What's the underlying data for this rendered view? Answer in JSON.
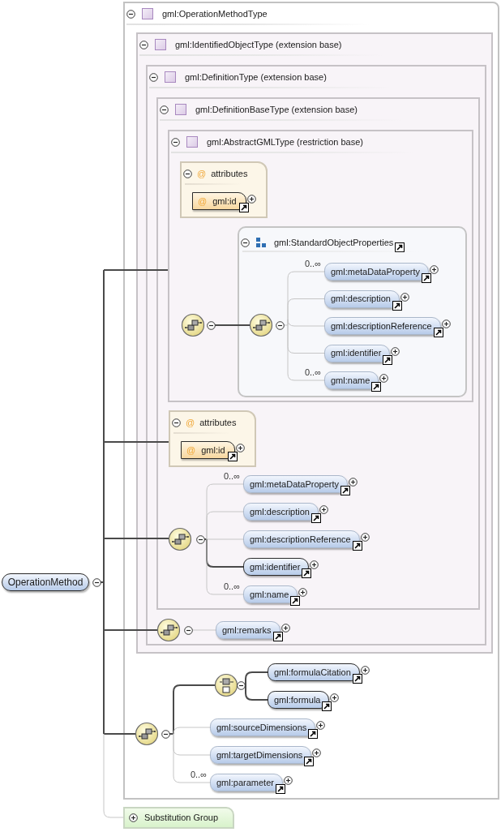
{
  "root": {
    "label": "OperationMethod"
  },
  "types": [
    {
      "title": "gml:OperationMethodType"
    },
    {
      "title": "gml:IdentifiedObjectType (extension base)"
    },
    {
      "title": "gml:DefinitionType (extension base)"
    },
    {
      "title": "gml:DefinitionBaseType (extension base)"
    },
    {
      "title": "gml:AbstractGMLType (restriction base)"
    }
  ],
  "inner_attributes": {
    "marker": "@",
    "title": "attributes",
    "items": [
      {
        "marker": "@",
        "label": "gml:id"
      }
    ]
  },
  "group": {
    "title": "gml:StandardObjectProperties",
    "elements": [
      {
        "label": "gml:metaDataProperty",
        "occurs": "0..∞",
        "required": false
      },
      {
        "label": "gml:description",
        "required": false
      },
      {
        "label": "gml:descriptionReference",
        "required": false
      },
      {
        "label": "gml:identifier",
        "required": false
      },
      {
        "label": "gml:name",
        "occurs": "0..∞",
        "required": false
      }
    ]
  },
  "outer_attributes": {
    "marker": "@",
    "title": "attributes",
    "items": [
      {
        "marker": "@",
        "label": "gml:id"
      }
    ]
  },
  "definition_sequence": {
    "elements": [
      {
        "label": "gml:metaDataProperty",
        "occurs": "0..∞",
        "required": false
      },
      {
        "label": "gml:description",
        "required": false
      },
      {
        "label": "gml:descriptionReference",
        "required": false
      },
      {
        "label": "gml:identifier",
        "required": true
      },
      {
        "label": "gml:name",
        "occurs": "0..∞",
        "required": false
      }
    ]
  },
  "remarks_sequence": {
    "elements": [
      {
        "label": "gml:remarks",
        "required": false
      }
    ]
  },
  "method_sequence": {
    "choice": {
      "required": true,
      "elements": [
        {
          "label": "gml:formulaCitation",
          "required": true
        },
        {
          "label": "gml:formula",
          "required": true
        }
      ]
    },
    "elements": [
      {
        "label": "gml:sourceDimensions",
        "required": false
      },
      {
        "label": "gml:targetDimensions",
        "required": false
      },
      {
        "label": "gml:parameter",
        "occurs": "0..∞",
        "required": false
      }
    ]
  },
  "substitution_group": {
    "label": "Substitution Group"
  }
}
